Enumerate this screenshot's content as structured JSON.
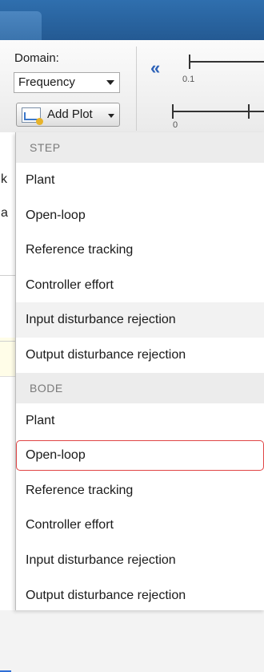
{
  "toolstrip": {
    "domain_label": "Domain:",
    "domain_value": "Frequency",
    "add_plot_label": "Add Plot",
    "slider_tick_1": "0.1",
    "slider_tick_2": "0"
  },
  "background_text": {
    "char1": "k",
    "char2": "a"
  },
  "menu": {
    "step_header": "STEP",
    "step_items": [
      "Plant",
      "Open-loop",
      "Reference tracking",
      "Controller effort",
      "Input disturbance rejection",
      "Output disturbance rejection"
    ],
    "bode_header": "BODE",
    "bode_items": [
      "Plant",
      "Open-loop",
      "Reference tracking",
      "Controller effort",
      "Input disturbance rejection",
      "Output disturbance rejection"
    ],
    "hovered_item": "STEP / Input disturbance rejection",
    "highlighted_item": "BODE / Open-loop"
  },
  "colors": {
    "title_bar": "#2f6fae",
    "highlight_border": "#e04545",
    "collapse_icon": "#2d62b8"
  }
}
